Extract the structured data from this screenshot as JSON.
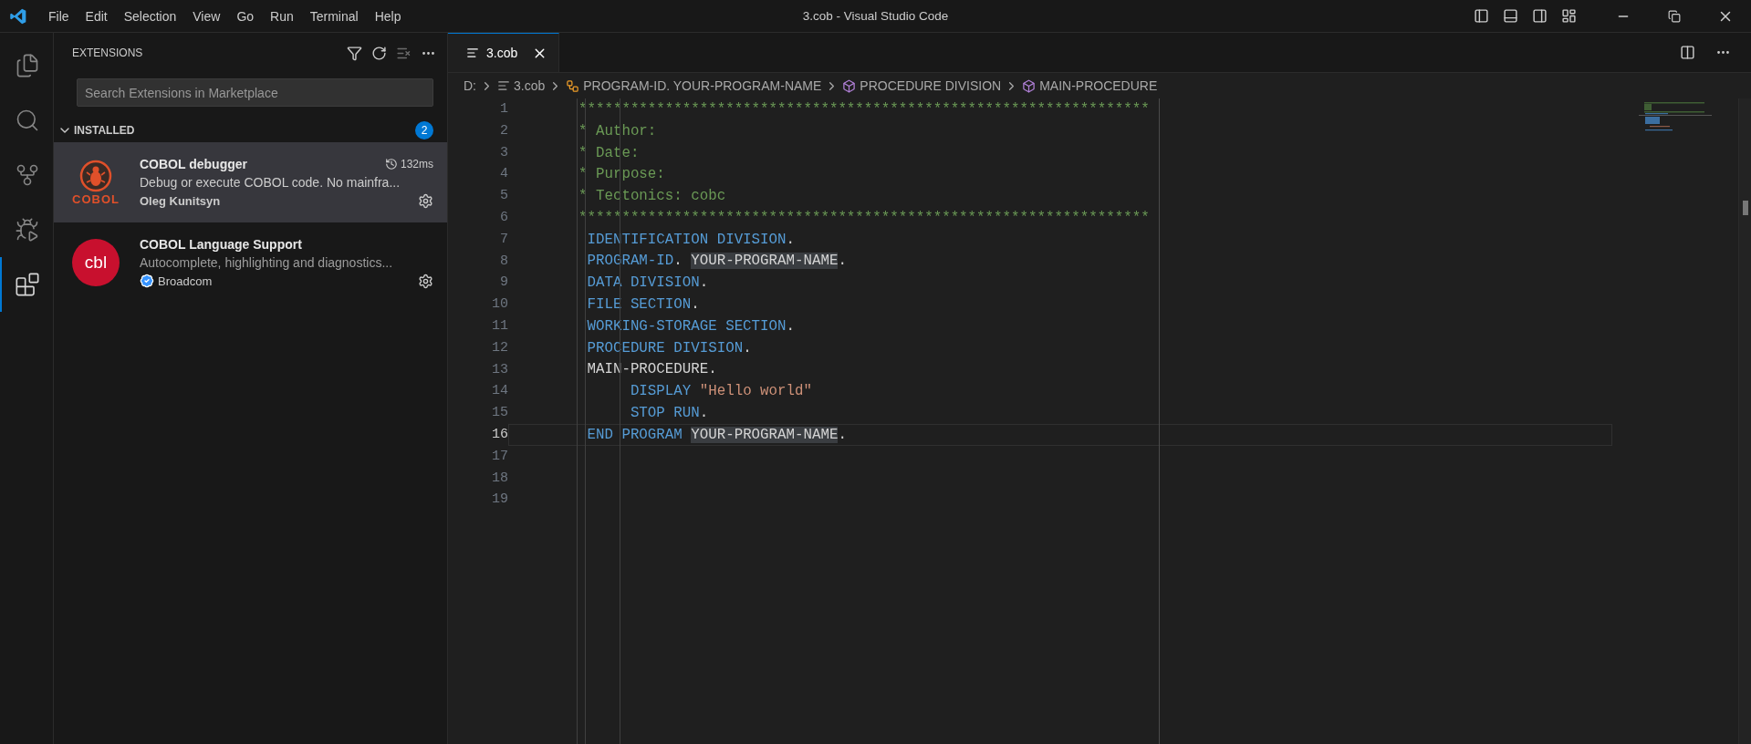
{
  "window": {
    "title": "3.cob - Visual Studio Code"
  },
  "menu": [
    "File",
    "Edit",
    "Selection",
    "View",
    "Go",
    "Run",
    "Terminal",
    "Help"
  ],
  "activity_bar": [
    {
      "kind": "explorer",
      "selected": false
    },
    {
      "kind": "search",
      "selected": false
    },
    {
      "kind": "source_control",
      "selected": false
    },
    {
      "kind": "run_debug",
      "selected": false
    },
    {
      "kind": "extensions",
      "selected": true
    }
  ],
  "sidebar": {
    "title": "EXTENSIONS",
    "search": {
      "placeholder": "Search Extensions in Marketplace"
    },
    "section": {
      "title": "INSTALLED",
      "expanded": true,
      "count": "2"
    },
    "extensions": [
      {
        "name": "COBOL debugger",
        "description": "Debug or execute COBOL code. No mainfra...",
        "publisher": "Oleg Kunitsyn",
        "verified": false,
        "time": "132ms",
        "selected": true,
        "kind": "debugger",
        "logo_text": "COBOL"
      },
      {
        "name": "COBOL Language Support",
        "description": "Autocomplete, highlighting and diagnostics...",
        "publisher": "Broadcom",
        "verified": true,
        "selected": false,
        "kind": "badge",
        "logo_text": "cbl"
      }
    ]
  },
  "tabs": [
    {
      "label": "3.cob",
      "selected": true
    }
  ],
  "breadcrumb": [
    {
      "label": "D:",
      "kind": "folder"
    },
    {
      "label": "3.cob",
      "kind": "file"
    },
    {
      "label": "PROGRAM-ID. YOUR-PROGRAM-NAME",
      "kind": "program"
    },
    {
      "label": "PROCEDURE DIVISION",
      "kind": "module"
    },
    {
      "label": "MAIN-PROCEDURE",
      "kind": "module"
    }
  ],
  "editor": {
    "lines": [
      {
        "number": "1",
        "current": false,
        "tokens": [
          {
            "text": "******************************************************************",
            "kind": "comment"
          }
        ]
      },
      {
        "number": "2",
        "current": false,
        "tokens": [
          {
            "text": "* Author:",
            "kind": "comment"
          }
        ]
      },
      {
        "number": "3",
        "current": false,
        "tokens": [
          {
            "text": "* Date:",
            "kind": "comment"
          }
        ]
      },
      {
        "number": "4",
        "current": false,
        "tokens": [
          {
            "text": "* Purpose:",
            "kind": "comment"
          }
        ]
      },
      {
        "number": "5",
        "current": false,
        "tokens": [
          {
            "text": "* Tectonics: cobc",
            "kind": "comment"
          }
        ]
      },
      {
        "number": "6",
        "current": false,
        "tokens": [
          {
            "text": "******************************************************************",
            "kind": "comment"
          }
        ]
      },
      {
        "number": "7",
        "current": false,
        "tokens": [
          {
            "text": " IDENTIFICATION DIVISION",
            "kind": "keyword"
          },
          {
            "text": ".",
            "kind": "plain"
          }
        ]
      },
      {
        "number": "8",
        "current": false,
        "tokens": [
          {
            "text": " PROGRAM-ID",
            "kind": "keyword"
          },
          {
            "text": ". ",
            "kind": "plain"
          },
          {
            "text": "YOUR-PROGRAM-NAME",
            "kind": "match"
          },
          {
            "text": ".",
            "kind": "plain"
          }
        ]
      },
      {
        "number": "9",
        "current": false,
        "tokens": [
          {
            "text": " DATA DIVISION",
            "kind": "keyword"
          },
          {
            "text": ".",
            "kind": "plain"
          }
        ]
      },
      {
        "number": "10",
        "current": false,
        "tokens": [
          {
            "text": " FILE SECTION",
            "kind": "keyword"
          },
          {
            "text": ".",
            "kind": "plain"
          }
        ]
      },
      {
        "number": "11",
        "current": false,
        "tokens": [
          {
            "text": " WORKING-STORAGE SECTION",
            "kind": "keyword"
          },
          {
            "text": ".",
            "kind": "plain"
          }
        ]
      },
      {
        "number": "12",
        "current": false,
        "tokens": [
          {
            "text": " PROCEDURE DIVISION",
            "kind": "keyword"
          },
          {
            "text": ".",
            "kind": "plain"
          }
        ]
      },
      {
        "number": "13",
        "current": false,
        "tokens": [
          {
            "text": " MAIN-PROCEDURE.",
            "kind": "plain"
          }
        ]
      },
      {
        "number": "14",
        "current": false,
        "tokens": [
          {
            "text": "      DISPLAY",
            "kind": "keyword"
          },
          {
            "text": " \"Hello world\"",
            "kind": "string"
          }
        ]
      },
      {
        "number": "15",
        "current": false,
        "tokens": [
          {
            "text": "      STOP RUN",
            "kind": "keyword"
          },
          {
            "text": ".",
            "kind": "plain"
          }
        ]
      },
      {
        "number": "16",
        "current": true,
        "tokens": [
          {
            "text": " END PROGRAM ",
            "kind": "keyword"
          },
          {
            "text": "YOUR-PROGRAM-NAME",
            "kind": "match"
          },
          {
            "text": ".",
            "kind": "plain"
          }
        ]
      },
      {
        "number": "17",
        "current": false
      },
      {
        "number": "18",
        "current": false
      },
      {
        "number": "19",
        "current": false
      }
    ]
  }
}
